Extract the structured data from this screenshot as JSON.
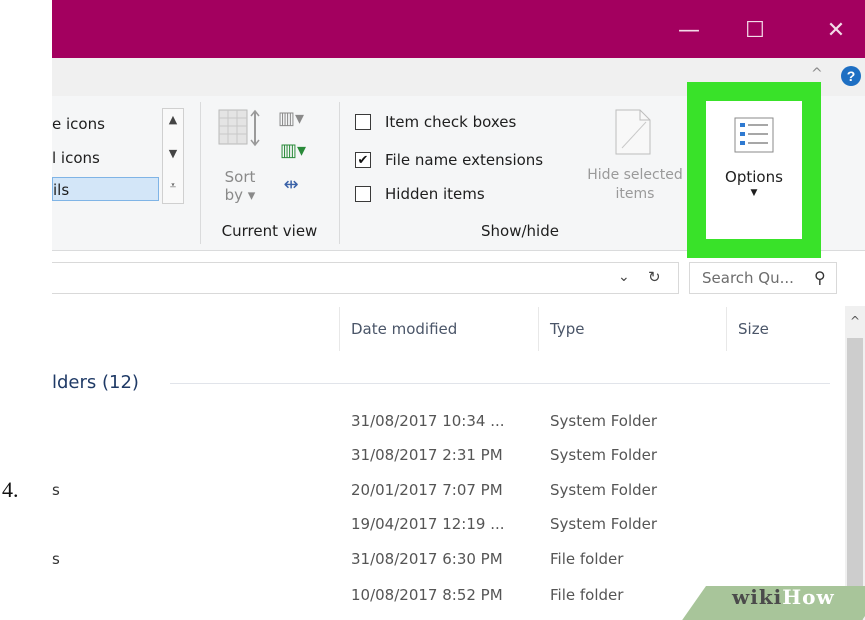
{
  "step_number": "4.",
  "titlebar": {
    "minimize_glyph": "—",
    "maximize_glyph": "☐",
    "close_glyph": "✕",
    "color": "#a3005f"
  },
  "ribbon": {
    "collapse_glyph": "^",
    "help_glyph": "?",
    "layout_items": [
      "e icons",
      "l icons",
      "ils"
    ],
    "current_view": {
      "sort_label_line1": "Sort",
      "sort_label_line2": "by ▾",
      "group_label": "Current view"
    },
    "show_hide": {
      "items": [
        {
          "label": "Item check boxes",
          "checked": false
        },
        {
          "label": "File name extensions",
          "checked": true
        },
        {
          "label": "Hidden items",
          "checked": false
        }
      ],
      "hide_selected_line1": "Hide selected",
      "hide_selected_line2": "items",
      "group_label": "Show/hide"
    },
    "options": {
      "label": "Options",
      "caret": "▼",
      "highlight_color": "#39e229"
    }
  },
  "address_bar": {
    "dropdown_glyph": "⌄",
    "refresh_glyph": "↻",
    "search_placeholder": "Search Qu...",
    "search_glyph": "⚲"
  },
  "columns": {
    "date_modified": "Date modified",
    "type": "Type",
    "size": "Size"
  },
  "group_header": "lders (12)",
  "rows": [
    {
      "name": "",
      "date": "31/08/2017 10:34 ...",
      "type": "System Folder"
    },
    {
      "name": "",
      "date": "31/08/2017 2:31 PM",
      "type": "System Folder"
    },
    {
      "name": "s",
      "date": "20/01/2017 7:07 PM",
      "type": "System Folder"
    },
    {
      "name": "",
      "date": "19/04/2017 12:19 ...",
      "type": "System Folder"
    },
    {
      "name": "s",
      "date": "31/08/2017 6:30 PM",
      "type": "File folder"
    },
    {
      "name": "",
      "date": "10/08/2017 8:52 PM",
      "type": "File folder"
    }
  ],
  "scrollbar_up_glyph": "^",
  "watermark": {
    "wiki": "wiki",
    "how": "How"
  }
}
